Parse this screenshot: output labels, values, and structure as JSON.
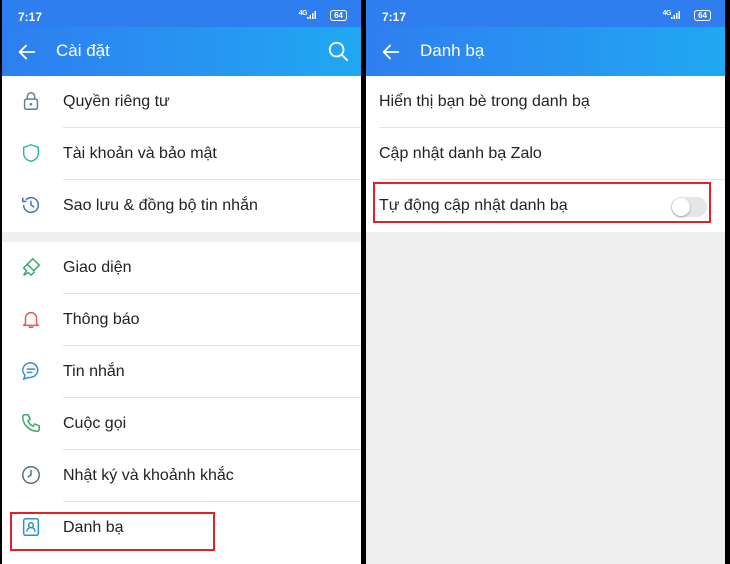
{
  "colors": {
    "header_start": "#2f7ef0",
    "header_end": "#20a8f2",
    "icon": "#2f7ef0",
    "highlight": "#e21f2b"
  },
  "left": {
    "status": {
      "time": "7:17",
      "network": "4G",
      "battery": "64"
    },
    "header": {
      "title": "Cài đặt"
    },
    "groups": [
      [
        {
          "icon": "lock-icon",
          "label": "Quyền riêng tư"
        },
        {
          "icon": "shield-icon",
          "label": "Tài khoản và bảo mật"
        },
        {
          "icon": "history-icon",
          "label": "Sao lưu & đồng bộ tin nhắn"
        }
      ],
      [
        {
          "icon": "paint-brush-icon",
          "label": "Giao diện"
        },
        {
          "icon": "bell-icon",
          "label": "Thông báo"
        },
        {
          "icon": "chat-bubble-icon",
          "label": "Tin nhắn"
        },
        {
          "icon": "phone-icon",
          "label": "Cuộc gọi"
        },
        {
          "icon": "clock-icon",
          "label": "Nhật ký và khoảnh khắc"
        },
        {
          "icon": "contact-card-icon",
          "label": "Danh bạ"
        }
      ]
    ]
  },
  "right": {
    "status": {
      "time": "7:17",
      "network": "4G",
      "battery": "64"
    },
    "header": {
      "title": "Danh bạ"
    },
    "items": [
      {
        "label": "Hiển thị bạn bè trong danh bạ"
      },
      {
        "label": "Cập nhật danh bạ Zalo"
      },
      {
        "label": "Tự động cập nhật danh bạ",
        "toggle": false
      }
    ]
  }
}
